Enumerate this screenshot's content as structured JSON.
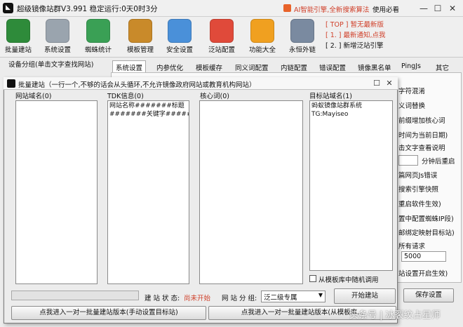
{
  "window": {
    "title": "超级镜像站群V3.991 稳定运行:0天0时3分",
    "notice": "AI智能引擎,全新搜索算法",
    "help": "使用必看",
    "minimize": "—",
    "maximize": "☐",
    "close": "✕"
  },
  "toolbar": [
    {
      "label": "批量建站",
      "color": "#2e8b3a"
    },
    {
      "label": "系统设置",
      "color": "#9aa4ae"
    },
    {
      "label": "蜘蛛统计",
      "color": "#3aa055"
    },
    {
      "label": "模板管理",
      "color": "#c98a2a"
    },
    {
      "label": "安全设置",
      "color": "#4a90d9"
    },
    {
      "label": "泛站配置",
      "color": "#e04a3a"
    },
    {
      "label": "功能大全",
      "color": "#f0a020"
    },
    {
      "label": "永恒外链",
      "color": "#7a8aa0"
    }
  ],
  "news": [
    "[ TOP ] 暂无最新版",
    "[ 1. ] 最新通知,点我",
    "[ 2. ] 新增泛站引擎"
  ],
  "group_label": "设备分组(单击文字查找网站)",
  "tabs": [
    "系统设置",
    "内参优化",
    "模板缓存",
    "同义词配置",
    "内链配置",
    "错误配置",
    "镜像黑名单",
    "PingJs",
    "其它"
  ],
  "right_panel": [
    "字符混淆",
    "义词替换",
    "前缀增加核心词",
    "时间为当前日期)",
    "击文字查看说明",
    "分钟后重启",
    "篇网页Js错误",
    "搜索引擎快照",
    "重启软件生效)",
    "置中配置蜘蛛IP段)",
    "邮绑定映射目标站)",
    "所有请求",
    "5000",
    "站设置开启生效)",
    "保存设置"
  ],
  "dialog": {
    "title": "批量建站（一行一个,不够的话会从头循环,不允许镜像政府网站或教育机构网站）",
    "max_btn": "☐",
    "close_btn": "✕",
    "columns": {
      "domain": {
        "header": "网站域名(0)",
        "content": ""
      },
      "tdk": {
        "header": "TDK信息(0)",
        "content": "网站名称#######标题\n#######关键字#######描述"
      },
      "keywords": {
        "header": "核心词(0)",
        "content": ""
      },
      "target": {
        "header": "目标站域名(1)",
        "content": "蚂蚁镜像站群系统\nTG:Mayiseo"
      }
    },
    "checkbox_label": "从模板库中随机调用",
    "status_label": "建 站 状 态:",
    "status_value": "尚未开始",
    "group_label": "网 站 分 组:",
    "group_value": "泛二级专属",
    "start_button": "开始建站",
    "bottom_left": "点我进入一对一批量建站版本(手动设置目标站)",
    "bottom_right": "点我进入一对一批量建站版本(从模板库..."
  },
  "watermark": "头条号 | 冰裂纹占星师"
}
